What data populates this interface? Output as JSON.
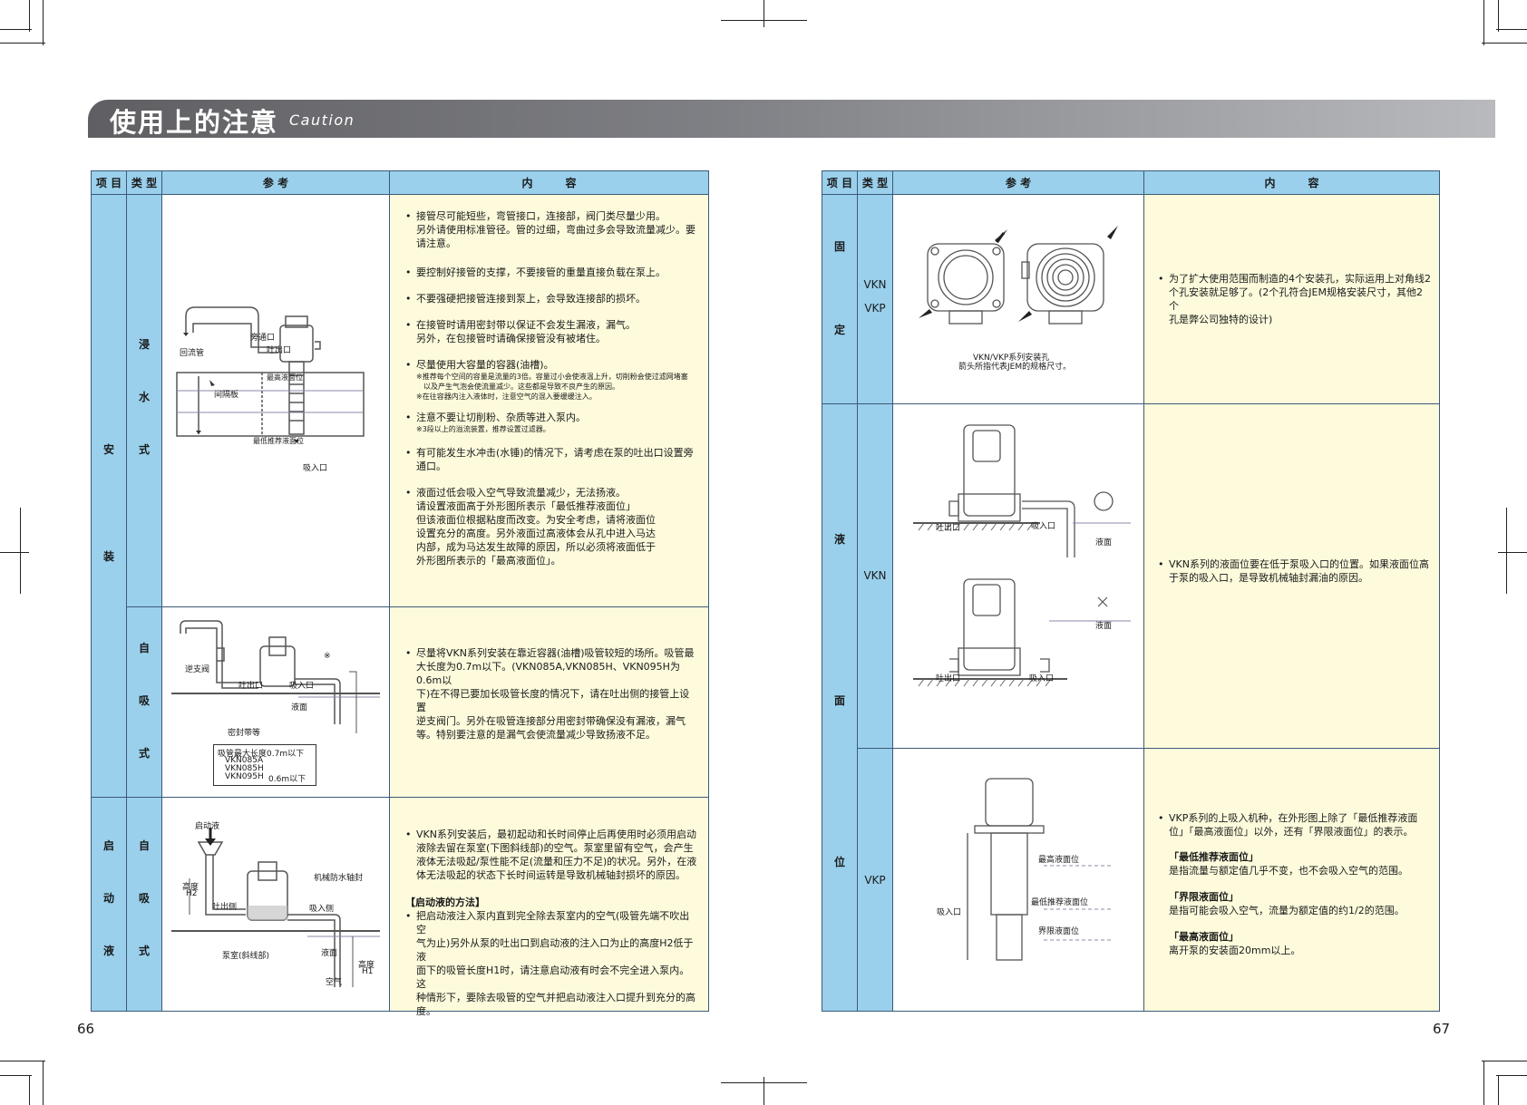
{
  "banner": {
    "title_zh": "使用上的注意",
    "title_en": "Caution"
  },
  "headers": {
    "item": "项 目",
    "type": "类 型",
    "ref": "参 考",
    "content": "内　　　容"
  },
  "left": {
    "item1": "安装",
    "item1_chars": [
      "安",
      "装"
    ],
    "item2_chars": [
      "启",
      "动",
      "液"
    ],
    "type1_chars": [
      "浸",
      "水",
      "式"
    ],
    "type2_chars": [
      "自",
      "吸",
      "式"
    ],
    "type3_chars": [
      "自",
      "吸",
      "式"
    ],
    "fig1": {
      "bypass": "旁通口",
      "outlet": "吐出口",
      "return": "回流管",
      "baffle": "间隔板",
      "max_level": "最高液面位",
      "min_level": "最低推荐液面位",
      "inlet": "吸入口"
    },
    "fig2": {
      "check_valve": "逆支阀",
      "outlet": "吐出口",
      "inlet": "吸入口",
      "liquid": "液面",
      "seal_tape": "密封带等",
      "star": "※",
      "max_len_title": "吸管最大长度0.7m以下",
      "m1": "VKN085A",
      "m2": "VKN085H",
      "m3": "VKN095H",
      "m_len": "0.6m以下"
    },
    "fig3": {
      "priming": "启动液",
      "height": "高度",
      "h2": "H2",
      "outlet_side": "吐出侧",
      "seal": "机械防水轴封",
      "inlet_side": "吸入侧",
      "chamber": "泵室(斜线部)",
      "liquid": "液面",
      "air": "空气",
      "h1_height": "高度",
      "h1": "H1"
    },
    "row1_bullets": [
      {
        "main": "接管尽可能短些，弯管接口，连接部，阀门类尽量少用。",
        "sub": [
          "另外请使用标准管径。管的过细，弯曲过多会导致流量减少。要",
          "请注意。"
        ]
      },
      {
        "main": "要控制好接管的支撑，不要接管的重量直接负载在泵上。",
        "sub": []
      },
      {
        "main": "不要强硬把接管连接到泵上，会导致连接部的损坏。",
        "sub": []
      },
      {
        "main": "在接管时请用密封带以保证不会发生漏液，漏气。",
        "sub": [
          "另外，在包接管时请确保接管没有被堵住。"
        ]
      },
      {
        "main": "尽量使用大容量的容器(油槽)。",
        "sub": []
      },
      {
        "main": "注意不要让切削粉、杂质等进入泵内。",
        "sub": []
      },
      {
        "main": "有可能发生水冲击(水锤)的情况下，请考虑在泵的吐出口设置旁",
        "sub": [
          "通口。"
        ]
      },
      {
        "main": "液面过低会吸入空气导致流量减少，无法扬液。",
        "sub": [
          "请设置液面高于外形图所表示「最低推荐液面位」",
          "但该液面位根据粘度而改变。为安全考虑，请将液面位",
          "设置充分的高度。另外液面过高液体会从孔中进入马达",
          "内部，成为马达发生故障的原因，所以必须将液面低于",
          "外形图所表示的「最高液面位」。"
        ]
      }
    ],
    "row1_notes": {
      "n1": "※推荐每个空间的容量是流量的3倍。容量过小会使液温上升，切削粉会使过滤网堵塞",
      "n2": "以及产生气泡会使流量减少。这些都是导致不良产生的原因。",
      "n3": "※在往容器内注入液体时，注意空气的混入要缓缓注入。",
      "n4": "※3段以上的溢流装置，推荐设置过滤器。"
    },
    "row2_text": [
      "尽量将VKN系列安装在靠近容器(油槽)吸管较短的场所。吸管最",
      "大长度为0.7m以下。(VKN085A,VKN085H、VKN095H为0.6m以",
      "下)在不得已要加长吸管长度的情况下，请在吐出侧的接管上设置",
      "逆支阀门。另外在吸管连接部分用密封带确保没有漏液，漏气",
      "等。特别要注意的是漏气会使流量减少导致扬液不足。"
    ],
    "row3_text": [
      "VKN系列安装后，最初起动和长时间停止后再使用时必须用启动",
      "液除去留在泵室(下图斜线部)的空气。泵室里留有空气，会产生",
      "液体无法吸起/泵性能不足(流量和压力不足)的状况。另外，在液",
      "体无法吸起的状态下长时间运转是导致机械轴封损坏的原因。"
    ],
    "row3_method_title": "【启动液的方法】",
    "row3_method": [
      "把启动液注入泵内直到完全除去泵室内的空气(吸管先端不吹出空",
      "气为止)另外从泵的吐出口到启动液的注入口为止的高度H2低于液",
      "面下的吸管长度H1时，请注意启动液有时会不完全进入泵内。这",
      "种情形下，要除去吸管的空气并把启动液注入口提升到充分的高",
      "度。"
    ],
    "page_num": "66"
  },
  "right": {
    "item1_chars": [
      "固",
      "定"
    ],
    "item2_chars": [
      "液",
      "面",
      "位"
    ],
    "type1": [
      "VKN",
      "VKP"
    ],
    "type2": "VKN",
    "type3": "VKP",
    "fig1_caption": [
      "VKN/VKP系列安装孔",
      "箭头所指代表JEM的规格尺寸。"
    ],
    "fig2": {
      "outlet": "吐出口",
      "inlet": "吸入口",
      "liquid": "液面"
    },
    "fig3": {
      "max": "最高液面位",
      "min": "最低推荐液面位",
      "limit": "界限液面位",
      "inlet": "吸入口"
    },
    "row1_text": [
      "为了扩大使用范围而制造的4个安装孔，实际运用上对角线2",
      "个孔安装就足够了。(2个孔符合JEM规格安装尺寸，其他2个",
      "孔是弊公司独特的设计)"
    ],
    "row2_text": [
      "VKN系列的液面位要在低于泵吸入口的位置。如果液面位高",
      "于泵的吸入口，是导致机械轴封漏油的原因。"
    ],
    "row3_text": [
      "VKP系列的上吸入机种，在外形图上除了「最低推荐液面",
      "位」「最高液面位」以外，还有「界限液面位」的表示。"
    ],
    "row3_defs": [
      {
        "title": "「最低推荐液面位」",
        "desc": "是指流量与额定值几乎不变，也不会吸入空气的范围。"
      },
      {
        "title": "「界限液面位」",
        "desc": "是指可能会吸入空气，流量为额定值的约1/2的范围。"
      },
      {
        "title": "「最高液面位」",
        "desc": "离开泵的安装面20mm以上。"
      }
    ],
    "page_num": "67"
  }
}
